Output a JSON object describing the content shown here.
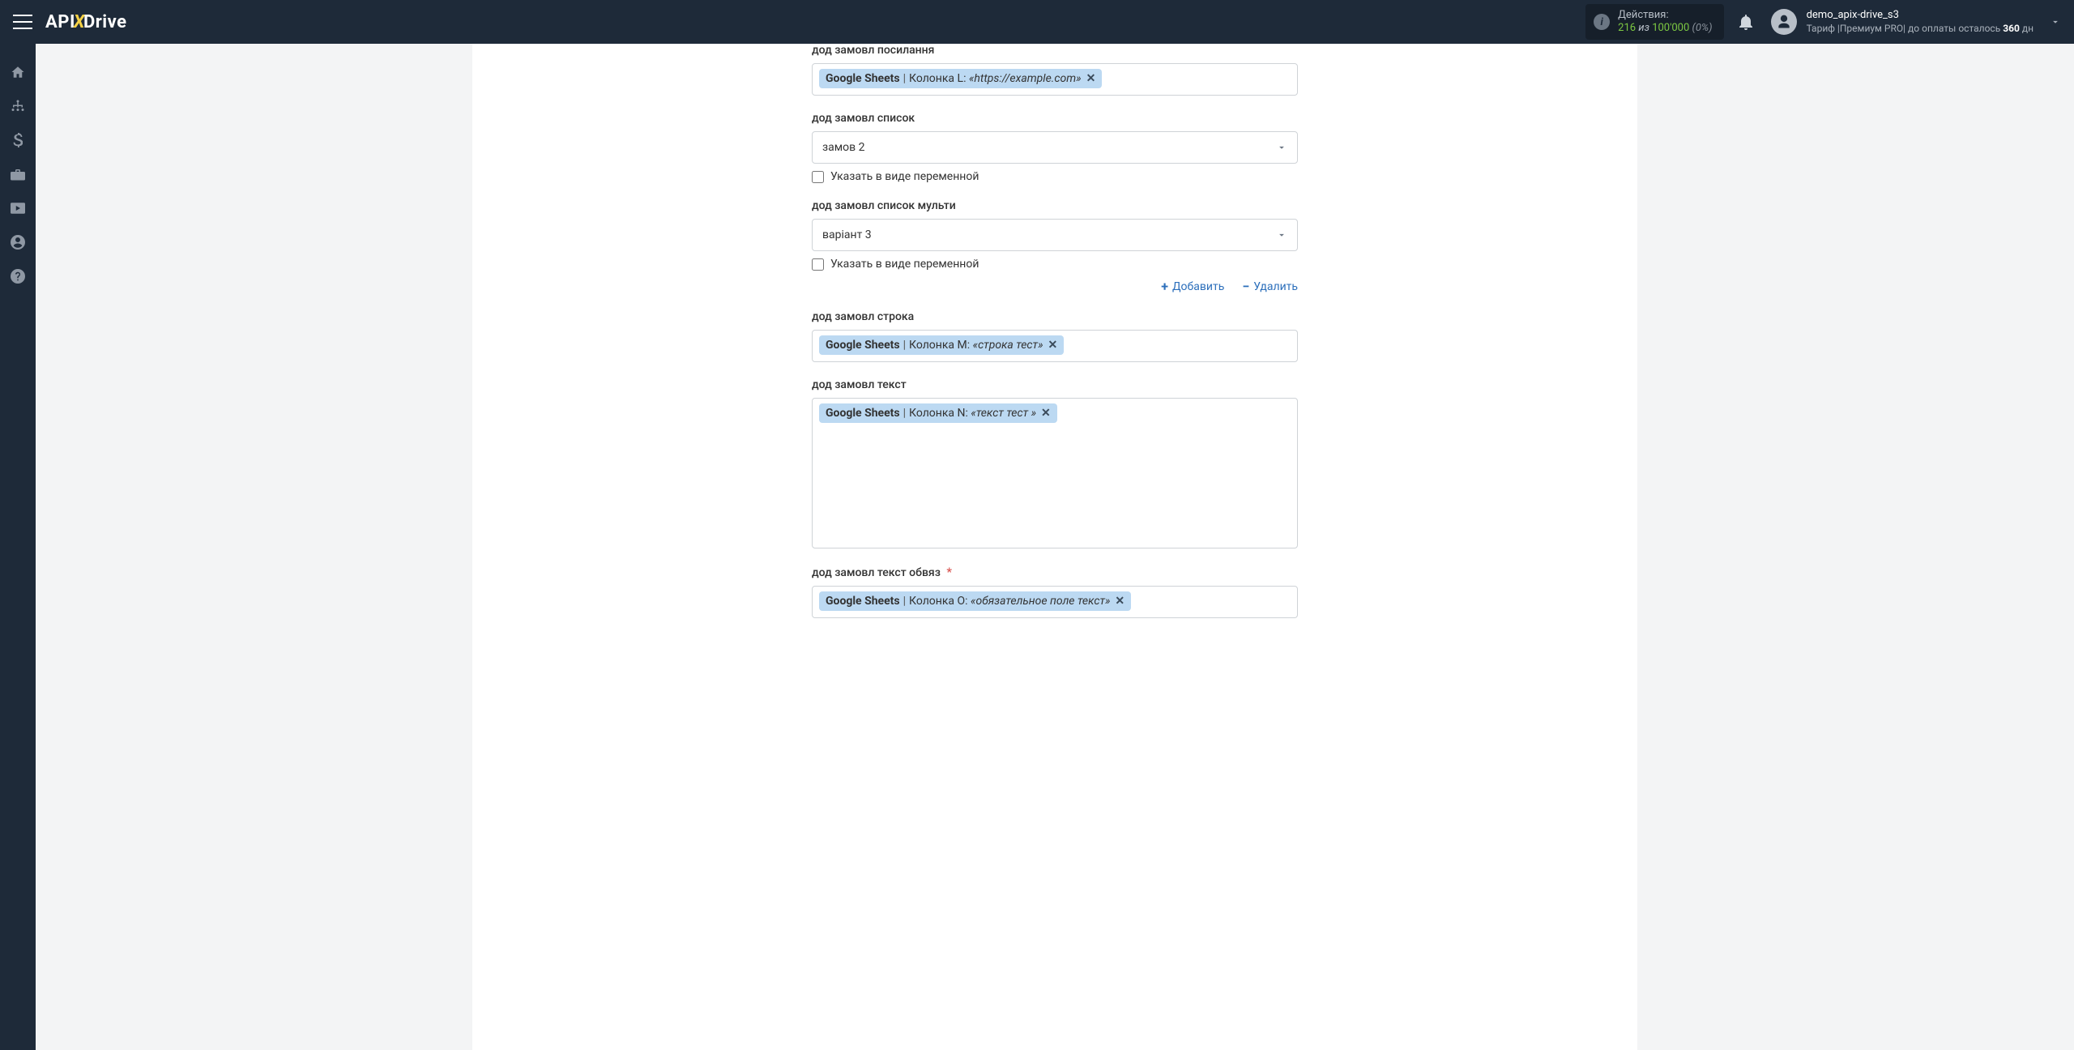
{
  "header": {
    "logo_api": "API",
    "logo_drive": "Drive",
    "actions_label": "Действия:",
    "actions_count": "216",
    "actions_of": " из ",
    "actions_total": "100'000",
    "actions_pct": "(0%)",
    "username": "demo_apix-drive_s3",
    "tariff_prefix": "Тариф |",
    "tariff_name": "Премиум PRO",
    "tariff_sep": "|  до оплаты осталось ",
    "days_left": "360",
    "days_suffix": " дн"
  },
  "fields": [
    {
      "label": "дод замовл посилання",
      "type": "token",
      "token": {
        "src": "Google Sheets",
        "col": "Колонка L:",
        "val": "«https://example.com»"
      }
    },
    {
      "label": "дод замовл список",
      "type": "select",
      "value": "замов 2",
      "checkbox": "Указать в виде переменной"
    },
    {
      "label": "дод замовл список мульти",
      "type": "select",
      "value": "варіант 3",
      "checkbox": "Указать в виде переменной",
      "add": "Добавить",
      "remove": "Удалить"
    },
    {
      "label": "дод замовл строка",
      "type": "token",
      "token": {
        "src": "Google Sheets",
        "col": "Колонка M:",
        "val": "«строка тест»"
      }
    },
    {
      "label": "дод замовл текст",
      "type": "token-tall",
      "token": {
        "src": "Google Sheets",
        "col": "Колонка N:",
        "val": "«текст тест »"
      }
    },
    {
      "label": "дод замовл текст обвяз",
      "required": true,
      "type": "token",
      "token": {
        "src": "Google Sheets",
        "col": "Колонка O:",
        "val": "«обязательное поле текст»"
      }
    }
  ]
}
